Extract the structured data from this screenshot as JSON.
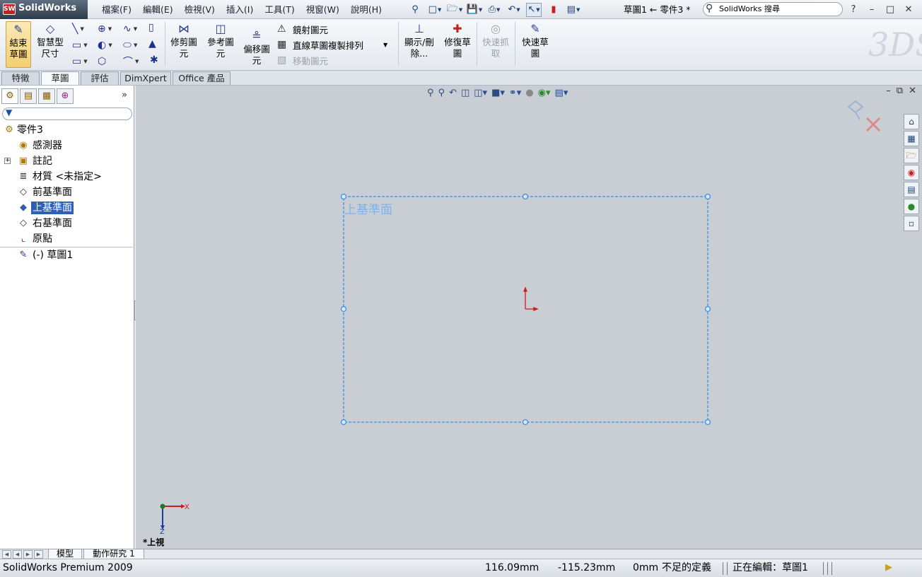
{
  "app": {
    "logo_text": "SolidWorks",
    "logo_badge": "SW"
  },
  "menu": [
    "檔案(F)",
    "編輯(E)",
    "檢視(V)",
    "插入(I)",
    "工具(T)",
    "視窗(W)",
    "說明(H)"
  ],
  "doc_title": "草圖1 ← 零件3 *",
  "search": {
    "placeholder": "SolidWorks 搜尋"
  },
  "command_manager": {
    "exit_sketch": "結束草圖",
    "smart_dimension": "智慧型尺寸",
    "trim_entities": "修剪圖元",
    "convert_entities": "參考圖元",
    "offset_entities": "偏移圖元",
    "mirror_entities": "鏡射圖元",
    "linear_pattern": "直線草圖複製排列",
    "move_entities": "移動圖元",
    "display_delete": "顯示/刪除...",
    "repair_sketch": "修復草圖",
    "quick_snaps": "快速抓取",
    "rapid_sketch": "快速草圖"
  },
  "tabs": [
    "特徵",
    "草圖",
    "評估",
    "DimXpert",
    "Office 產品"
  ],
  "active_tab": 1,
  "feature_tree": {
    "root": "零件3",
    "items": [
      {
        "label": "感測器",
        "icon": "sensor-icon"
      },
      {
        "label": "註記",
        "icon": "annotation-icon",
        "expandable": true
      },
      {
        "label": "材質 <未指定>",
        "icon": "material-icon"
      },
      {
        "label": "前基準面",
        "icon": "plane-icon"
      },
      {
        "label": "上基準面",
        "icon": "plane-icon",
        "selected": true
      },
      {
        "label": "右基準面",
        "icon": "plane-icon"
      },
      {
        "label": "原點",
        "icon": "origin-icon"
      }
    ],
    "sketch": "(-) 草圖1"
  },
  "viewport": {
    "plane_label": "上基準面",
    "view_name": "*上視",
    "axis_x": "X",
    "axis_z": "Z",
    "sketch_color": "#3d8fe0",
    "origin_color": "#d11a1a"
  },
  "bottom_tabs": [
    "模型",
    "動作研究 1"
  ],
  "status": {
    "product": "SolidWorks Premium 2009",
    "x": "116.09mm",
    "y": "-115.23mm",
    "z": "0mm",
    "definition": "不足的定義",
    "editing": "正在編輯：草圖1"
  }
}
